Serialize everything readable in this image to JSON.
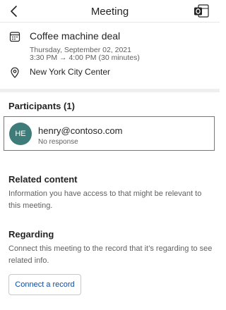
{
  "header": {
    "title": "Meeting",
    "back_icon": "chevron-left-icon",
    "outlook_icon": "outlook-icon"
  },
  "event": {
    "title": "Coffee machine deal",
    "date": "Thursday, September 02, 2021",
    "start_time": "3:30 PM",
    "end_time": "4:00 PM",
    "duration": "(30 minutes)",
    "location": "New York City Center",
    "calendar_icon": "calendar-icon",
    "location_icon": "location-pin-icon"
  },
  "participants": {
    "title": "Participants (1)",
    "items": [
      {
        "initials": "HE",
        "email": "henry@contoso.com",
        "status": "No response",
        "avatar_color": "#3e7c7a"
      }
    ],
    "highlight_color": "#e8474f"
  },
  "related": {
    "title": "Related content",
    "description": "Information you have access to that might be relevant to this meeting."
  },
  "regarding": {
    "title": "Regarding",
    "description": "Connect this meeting to the record that it’s regarding to see related info.",
    "button_label": "Connect a record",
    "button_color": "#0f4c9c"
  }
}
